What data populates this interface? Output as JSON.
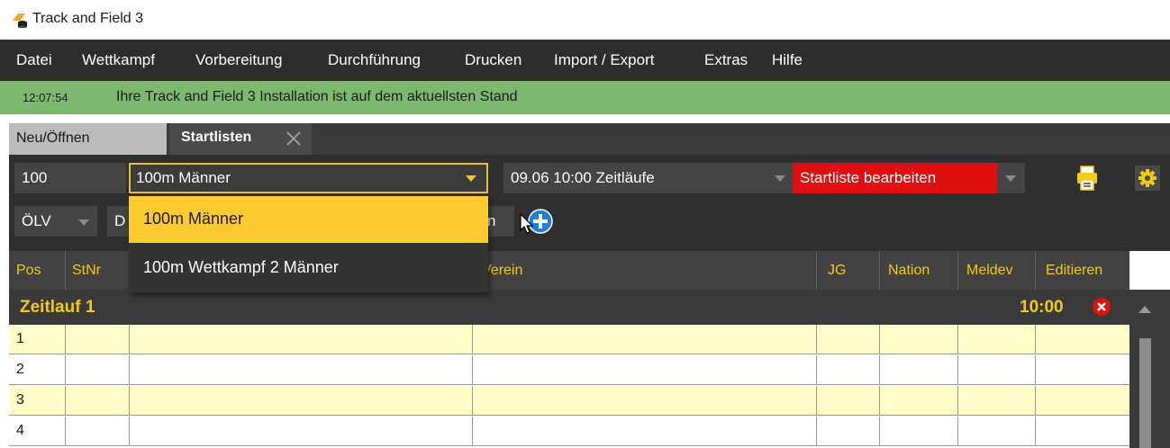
{
  "window": {
    "title": "Track and Field 3"
  },
  "menu": [
    "Datei",
    "Wettkampf",
    "Vorbereitung",
    "Durchführung",
    "Drucken",
    "Import / Export",
    "Extras",
    "Hilfe"
  ],
  "status": {
    "time": "12:07:54",
    "message": "Ihre Track and Field 3 Installation ist auf dem aktuellsten Stand",
    "color": "#7cb96f"
  },
  "tabs": [
    {
      "label": "Neu/Öffnen",
      "active": false
    },
    {
      "label": "Startlisten",
      "active": true
    }
  ],
  "toolbar": {
    "event_number": "100",
    "event_selected": "100m Männer",
    "heat_selected": "09.06 10:00 Zeitläufe",
    "list_status": "Startliste bearbeiten",
    "federation": "ÖLV",
    "second_prefix": "D",
    "second_suffix": "n",
    "print_icon": "printer-icon",
    "settings_icon": "gear-icon",
    "add_icon": "plus-circle-icon"
  },
  "dropdown": {
    "options": [
      "100m Männer",
      "100m Wettkampf 2 Männer"
    ],
    "highlighted_index": 0
  },
  "table": {
    "columns": [
      "Pos",
      "StNr",
      "Verein",
      "JG",
      "Nation",
      "Meldev",
      "Editieren"
    ],
    "group": {
      "name": "Zeitlauf 1",
      "time": "10:00"
    },
    "rows": [
      {
        "pos": "1"
      },
      {
        "pos": "2"
      },
      {
        "pos": "3"
      },
      {
        "pos": "4"
      }
    ]
  },
  "colors": {
    "accent": "#f3c91c",
    "danger": "#e01010",
    "dark": "#2d2d2d"
  }
}
